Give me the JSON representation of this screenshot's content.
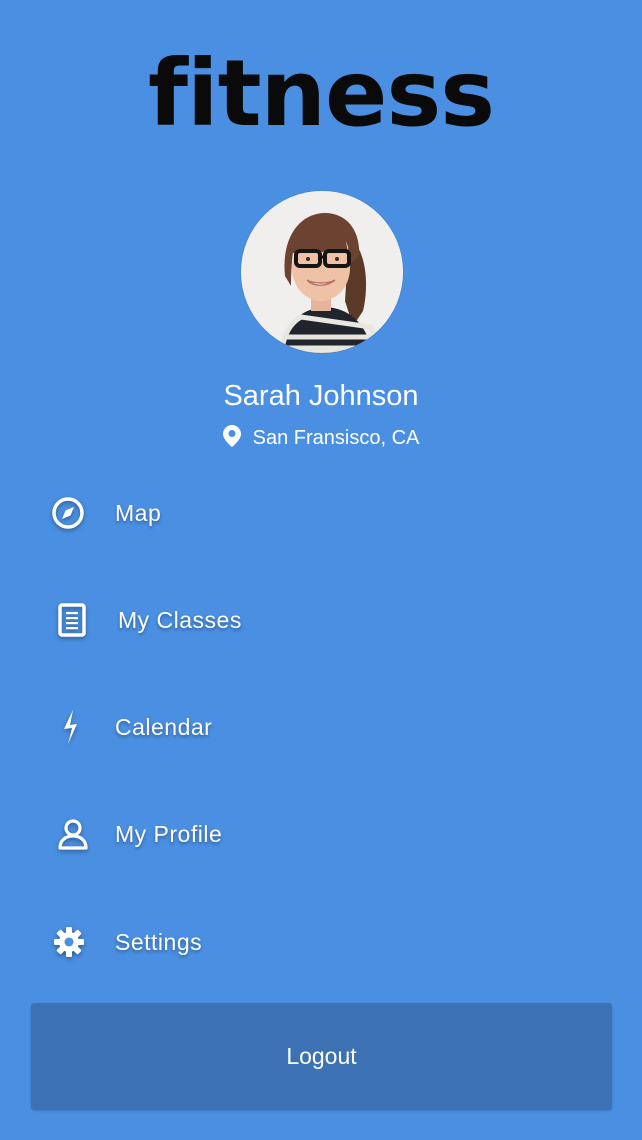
{
  "app": {
    "logo": "fitness"
  },
  "profile": {
    "name": "Sarah Johnson",
    "location": "San Fransisco, CA",
    "location_icon": "map-pin-icon",
    "avatar_icon": "user-photo"
  },
  "menu": {
    "items": [
      {
        "label": "Map",
        "icon": "compass-icon"
      },
      {
        "label": "My Classes",
        "icon": "document-list-icon"
      },
      {
        "label": "Calendar",
        "icon": "lightning-icon"
      },
      {
        "label": "My Profile",
        "icon": "user-icon"
      },
      {
        "label": "Settings",
        "icon": "gear-icon"
      }
    ]
  },
  "actions": {
    "logout_label": "Logout"
  },
  "colors": {
    "background": "#4a8fe2",
    "logout_button": "#3c72b4",
    "logo_text": "#0a0a0a",
    "text": "#ffffff"
  }
}
